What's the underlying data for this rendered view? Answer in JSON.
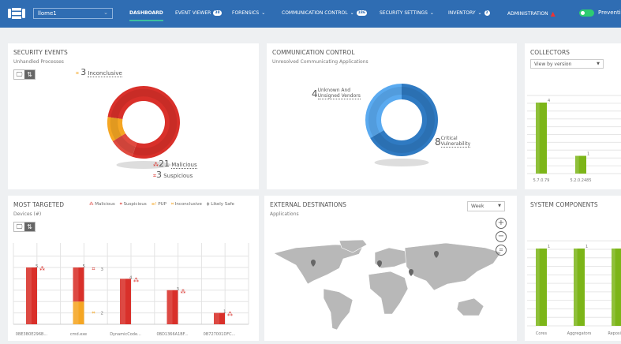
{
  "header": {
    "site_selector": "llome1",
    "nav": [
      {
        "label": "DASHBOARD",
        "active": true
      },
      {
        "label": "EVENT VIEWER",
        "badge": "38"
      },
      {
        "label": "FORENSICS",
        "chevron": true
      },
      {
        "label": "COMMUNICATION CONTROL",
        "chevron": true,
        "badge": "186"
      },
      {
        "label": "SECURITY SETTINGS",
        "chevron": true
      },
      {
        "label": "INVENTORY",
        "chevron": true,
        "badge": "2"
      },
      {
        "label": "ADMINISTRATION",
        "warning": true
      }
    ],
    "mode_label": "Prevention",
    "mode_on": true
  },
  "security_events": {
    "title": "SECURITY EVENTS",
    "subtitle": "Unhandled Processes",
    "chart_data": {
      "type": "pie",
      "series": [
        {
          "name": "Malicious",
          "value": 21,
          "color": "#d9302a"
        },
        {
          "name": "Suspicious",
          "value": 3,
          "color": "#e04a3f"
        },
        {
          "name": "Inconclusive",
          "value": 3,
          "color": "#f5a623"
        }
      ]
    }
  },
  "communication_control": {
    "title": "COMMUNICATION CONTROL",
    "subtitle": "Unresolved Communicating Applications",
    "chart_data": {
      "type": "pie",
      "series": [
        {
          "name": "Critical Vulnerability",
          "value": 8,
          "color": "#2f7ac2"
        },
        {
          "name": "Unknown And Unsigned Vendors",
          "value": 4,
          "color": "#5aaaf0"
        }
      ]
    },
    "labels": {
      "unknown_value": "4",
      "unknown_line1": "Unknown And",
      "unknown_line2": "Unsigned Vendors",
      "critical_value": "8",
      "critical_line1": "Critical",
      "critical_line2": "Vulnerability"
    }
  },
  "collectors": {
    "title": "COLLECTORS",
    "dropdown": "View by version",
    "chart_data": {
      "type": "bar",
      "categories": [
        "5.7.0.79",
        "5.2.0.2485"
      ],
      "values": [
        4,
        1
      ],
      "ylim": [
        0,
        4
      ],
      "color": "#7cb518"
    }
  },
  "most_targeted": {
    "title": "MOST TARGETED",
    "subtitle": "Devices (#)",
    "legend": [
      {
        "label": "Malicious",
        "color": "#d9302a"
      },
      {
        "label": "Suspicious",
        "color": "#d9302a"
      },
      {
        "label": "PUP",
        "color": "#f5a623"
      },
      {
        "label": "Inconclusive",
        "color": "#f5a623"
      },
      {
        "label": "Likely Safe",
        "color": "#666"
      }
    ],
    "chart_data": {
      "type": "bar",
      "stacked": true,
      "categories": [
        "0BE3B0E296B...",
        "cmd.exe",
        "DynamicCode...",
        "0BD1366A1BF...",
        "0B727001DFC..."
      ],
      "series": [
        {
          "name": "Inconclusive",
          "values": [
            0,
            2,
            0,
            0,
            0
          ],
          "color": "#f5a623"
        },
        {
          "name": "Malicious",
          "values": [
            5,
            3,
            4,
            3,
            1
          ],
          "color": "#d9302a"
        }
      ],
      "totals": [
        5,
        5,
        4,
        3,
        1
      ],
      "ylim": [
        0,
        5
      ]
    }
  },
  "external_destinations": {
    "title": "EXTERNAL DESTINATIONS",
    "subtitle": "Applications",
    "period": "Week"
  },
  "system_components": {
    "title": "SYSTEM COMPONENTS",
    "chart_data": {
      "type": "bar",
      "categories": [
        "Cores",
        "Aggregators",
        "Reposit..."
      ],
      "values": [
        1,
        1,
        1
      ],
      "ylim": [
        0,
        1
      ],
      "color": "#7cb518"
    }
  }
}
